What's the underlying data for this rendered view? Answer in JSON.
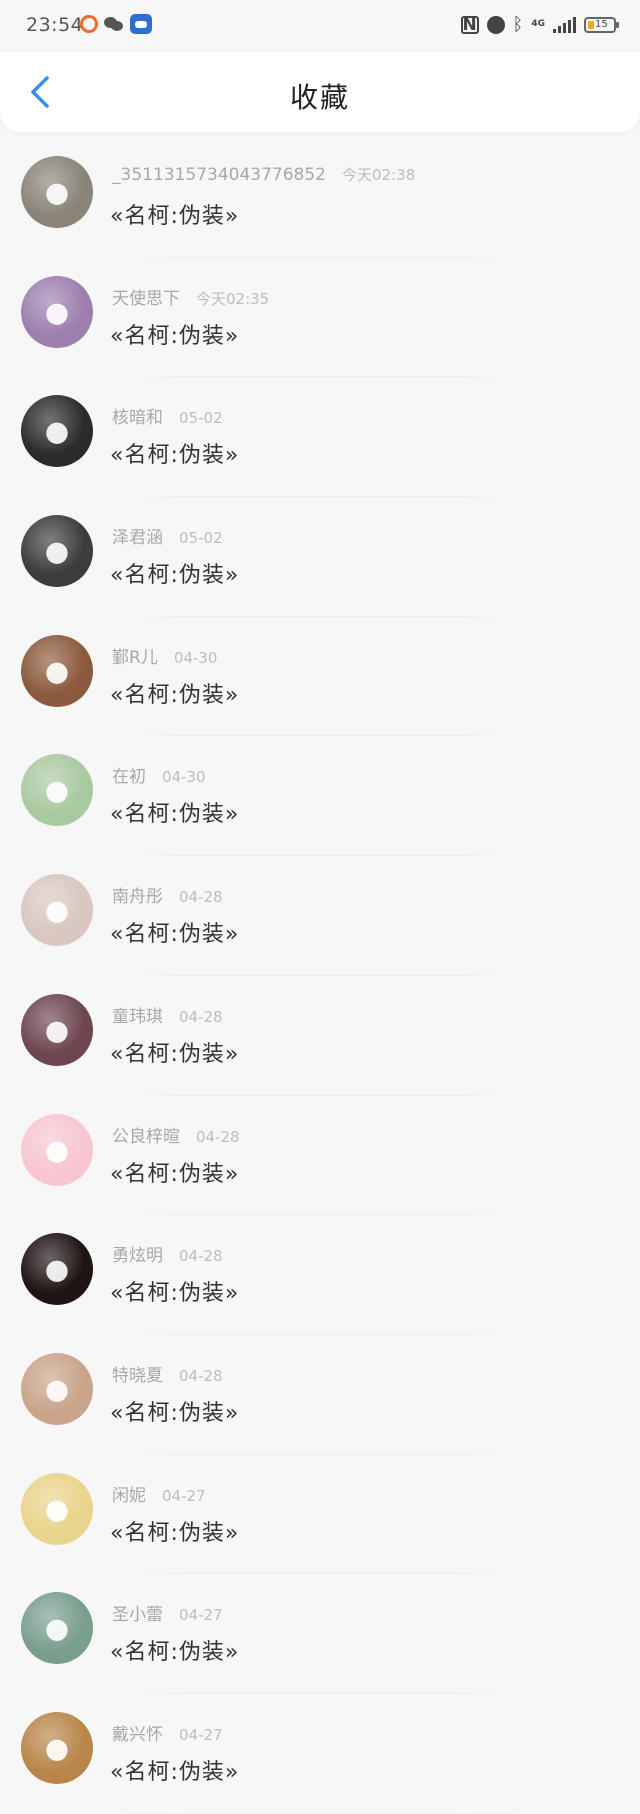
{
  "status_bar": {
    "time": "23:54",
    "net": "4G",
    "battery": "15"
  },
  "header": {
    "title": "收藏"
  },
  "favorites": [
    {
      "name": "_3511315734043776852",
      "time": "今天02:38",
      "content": "«名柯:伪装»",
      "avatar_color": "#8a8478",
      "avatar_icon": "cat-avatar"
    },
    {
      "name": "天使思下",
      "time": "今天02:35",
      "content": "«名柯:伪装»",
      "avatar_color": "#9d7fae",
      "avatar_icon": "angel-avatar"
    },
    {
      "name": "核暗和",
      "time": "05-02",
      "content": "«名柯:伪装»",
      "avatar_color": "#2b2b2b",
      "avatar_icon": "girl-bw-avatar"
    },
    {
      "name": "泽君涵",
      "time": "05-02",
      "content": "«名柯:伪装»",
      "avatar_color": "#3c3c3c",
      "avatar_icon": "anime-bw-avatar"
    },
    {
      "name": "鄞R儿",
      "time": "04-30",
      "content": "«名柯:伪装»",
      "avatar_color": "#8b5a3c",
      "avatar_icon": "bear-avatar"
    },
    {
      "name": "在初",
      "time": "04-30",
      "content": "«名柯:伪装»",
      "avatar_color": "#a9c9a0",
      "avatar_icon": "pinwheel-avatar"
    },
    {
      "name": "南舟彤",
      "time": "04-28",
      "content": "«名柯:伪装»",
      "avatar_color": "#d9c7c0",
      "avatar_icon": "kitten-avatar"
    },
    {
      "name": "童玮琪",
      "time": "04-28",
      "content": "«名柯:伪装»",
      "avatar_color": "#6e4650",
      "avatar_icon": "anime-boy-avatar"
    },
    {
      "name": "公良梓暄",
      "time": "04-28",
      "content": "«名柯:伪装»",
      "avatar_color": "#f7c6cf",
      "avatar_icon": "pig-avatar"
    },
    {
      "name": "勇炫明",
      "time": "04-28",
      "content": "«名柯:伪装»",
      "avatar_color": "#1f1414",
      "avatar_icon": "flower-avatar"
    },
    {
      "name": "特晓夏",
      "time": "04-28",
      "content": "«名柯:伪装»",
      "avatar_color": "#c9a48a",
      "avatar_icon": "woman-avatar"
    },
    {
      "name": "闲妮",
      "time": "04-27",
      "content": "«名柯:伪装»",
      "avatar_color": "#e8d48a",
      "avatar_icon": "girl-light-avatar"
    },
    {
      "name": "圣小蕾",
      "time": "04-27",
      "content": "«名柯:伪装»",
      "avatar_color": "#7a9e8e",
      "avatar_icon": "anime-girl-avatar"
    },
    {
      "name": "戴兴怀",
      "time": "04-27",
      "content": "«名柯:伪装»",
      "avatar_color": "#b8864a",
      "avatar_icon": "anime-blond-avatar"
    }
  ]
}
